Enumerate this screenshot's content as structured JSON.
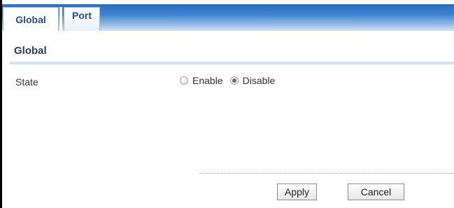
{
  "tabs": [
    {
      "label": "Global"
    },
    {
      "label": "Port"
    }
  ],
  "section": {
    "title": "Global"
  },
  "state_field": {
    "label": "State",
    "options": [
      {
        "label": "Enable",
        "checked": false
      },
      {
        "label": "Disable",
        "checked": true
      }
    ]
  },
  "buttons": {
    "apply": "Apply",
    "cancel": "Cancel"
  },
  "colors": {
    "tabbar_dark": "#2c6fbf",
    "tabbar_light": "#cfe1f4",
    "section_title": "#2a3f63",
    "section_rule": "#d5e2f2"
  }
}
